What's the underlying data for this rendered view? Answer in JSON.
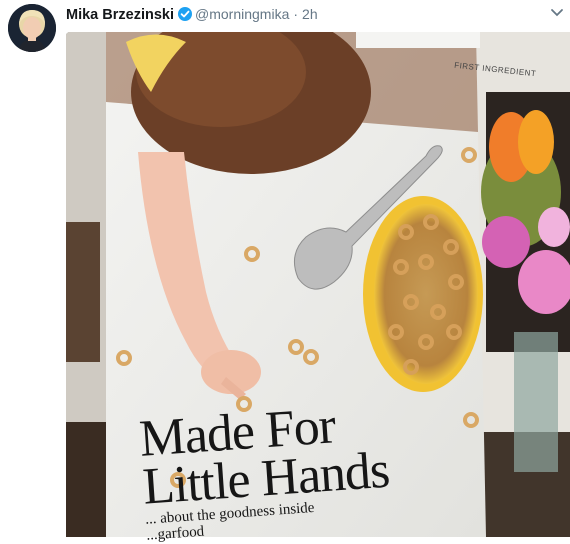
{
  "tweet": {
    "author": {
      "display_name": "Mika Brzezinski",
      "handle": "@morningmika",
      "verified": true
    },
    "separator": "·",
    "timestamp": "2h"
  },
  "image": {
    "box_banner": "FIRST INGREDIENT",
    "headline_line1": "Made For",
    "headline_line2": "Little Hands",
    "subline_line1": "... about the goodness inside",
    "subline_line2": "...garfood"
  }
}
